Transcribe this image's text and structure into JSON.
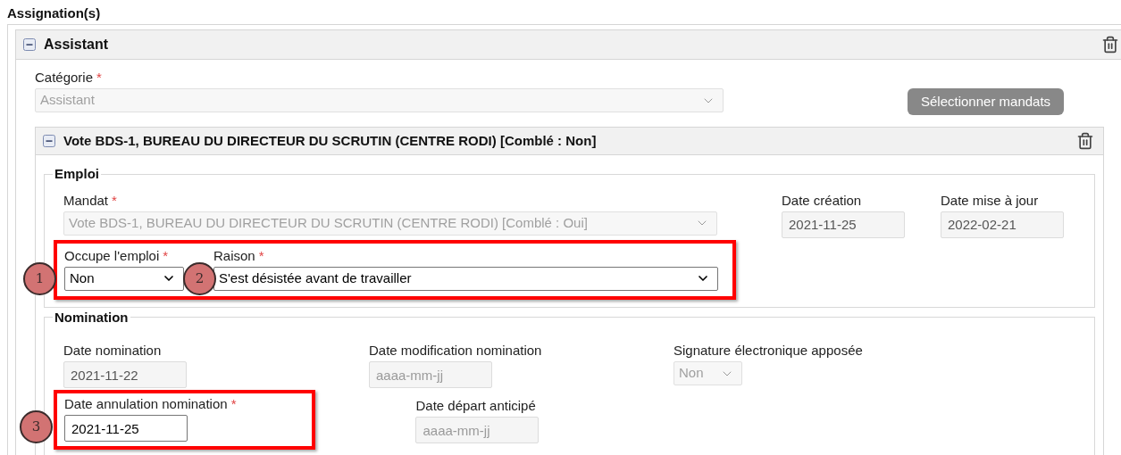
{
  "section_title": "Assignation(s)",
  "assignment": {
    "title": "Assistant",
    "expanded": true,
    "category": {
      "kind": "select",
      "label": "Catégorie",
      "required_mark": "*",
      "disabled": true,
      "value": "Assistant"
    },
    "select_button": "Sélectionner mandats",
    "vote": {
      "title": "Vote BDS-1, BUREAU DU DIRECTEUR DU SCRUTIN (CENTRE RODI) [Comblé : Non]",
      "expanded": true,
      "emploi": {
        "legend": "Emploi",
        "rows": [
          {
            "highlighted": false,
            "fields": [
              {
                "kind": "select",
                "label": "Mandat",
                "required_mark": "*",
                "disabled": true,
                "value": "Vote BDS-1, BUREAU DU DIRECTEUR DU SCRUTIN (CENTRE RODI) [Comblé : Oui]"
              },
              {
                "kind": "input",
                "label": "Date création",
                "disabled": true,
                "value": "2021-11-25"
              },
              {
                "kind": "input",
                "label": "Date mise à jour",
                "disabled": true,
                "value": "2022-02-21"
              }
            ]
          },
          {
            "highlighted": true,
            "fields": [
              {
                "kind": "select",
                "label": "Occupe l'emploi",
                "required_mark": "*",
                "disabled": false,
                "value": "Non",
                "marker": "1"
              },
              {
                "kind": "select",
                "label": "Raison",
                "required_mark": "*",
                "disabled": false,
                "value": "S'est désistée avant de travailler",
                "marker": "2"
              }
            ]
          }
        ]
      },
      "nomination": {
        "legend": "Nomination",
        "rows": [
          {
            "fields": [
              {
                "kind": "input",
                "label": "Date nomination",
                "disabled": true,
                "value": "2021-11-22",
                "highlighted": false
              },
              {
                "kind": "input",
                "label": "Date modification nomination",
                "disabled": true,
                "placeholder": "aaaa-mm-jj",
                "highlighted": false
              },
              {
                "kind": "select",
                "label": "Signature électronique apposée",
                "disabled": true,
                "value": "Non",
                "highlighted": false
              }
            ]
          },
          {
            "fields": [
              {
                "kind": "input",
                "label": "Date annulation nomination",
                "required_mark": "*",
                "disabled": false,
                "value": "2021-11-25",
                "highlighted": true,
                "marker": "3"
              },
              {
                "kind": "input",
                "label": "Date départ anticipé",
                "disabled": true,
                "placeholder": "aaaa-mm-jj",
                "highlighted": false
              }
            ]
          }
        ]
      }
    }
  }
}
